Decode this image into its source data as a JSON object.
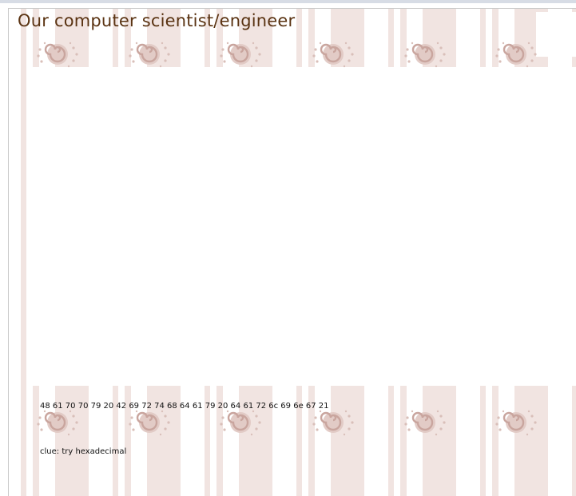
{
  "page": {
    "title": "Our computer scientist/engineer",
    "hex_message": "48 61 70 70 79 20 42 69 72 74 68 64 61 79 20 64 61 72 6c 69 6e 67 21",
    "clue": "clue: try hexadecimal"
  },
  "decor": {
    "stripe_color": "#f1e4e1",
    "swirl_color": "#d7bcb6",
    "title_color": "#5a3312",
    "swirl_icon": "swirl-icon"
  }
}
